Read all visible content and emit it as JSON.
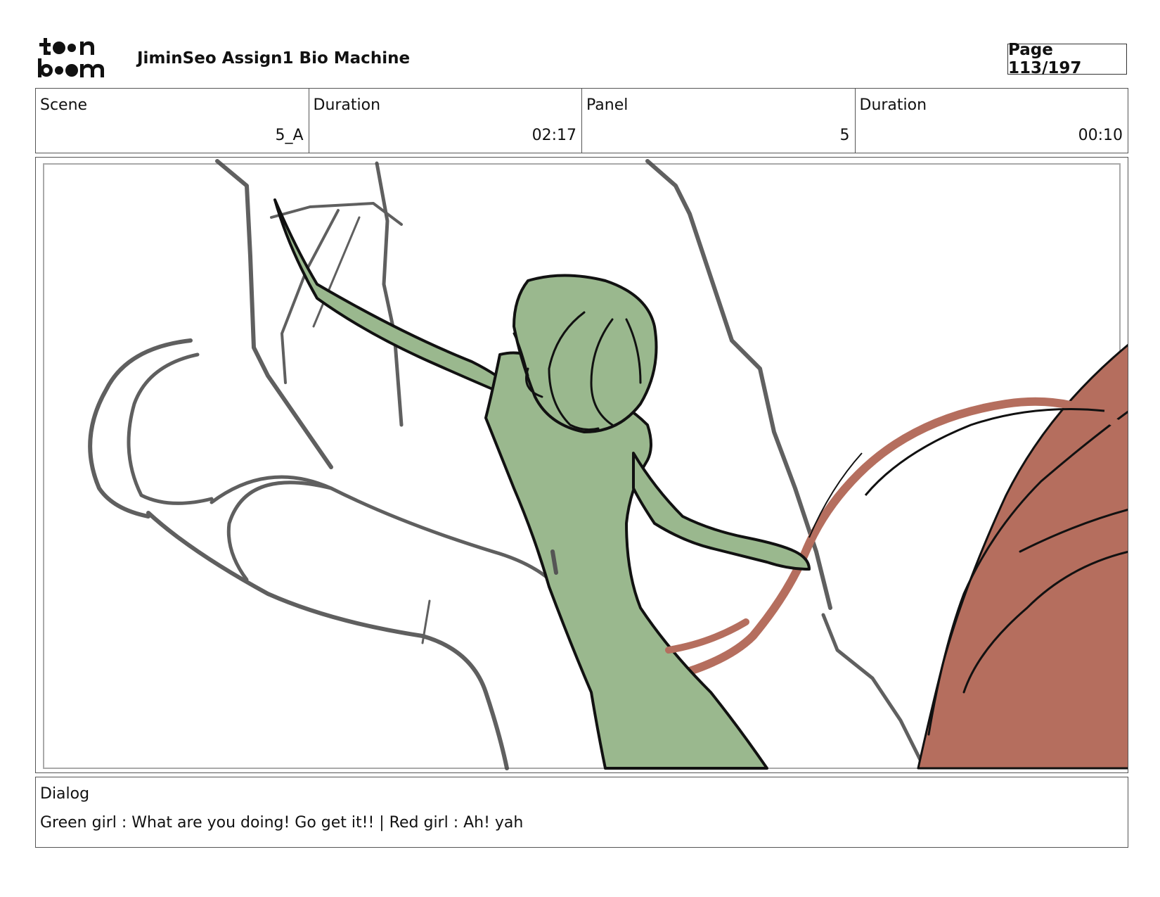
{
  "header": {
    "logo_text": "toon boom",
    "title": "JiminSeo Assign1 Bio Machine",
    "page": "Page 113/197"
  },
  "info": {
    "scene_label": "Scene",
    "scene_value": "5_A",
    "scene_duration_label": "Duration",
    "scene_duration_value": "02:17",
    "panel_label": "Panel",
    "panel_value": "5",
    "panel_duration_label": "Duration",
    "panel_duration_value": "00:10"
  },
  "panel_image": {
    "description_colors": {
      "green_character": "#9ab88e",
      "red_character": "#b56e5e",
      "sketch_lines": "#555555"
    }
  },
  "dialog": {
    "label": "Dialog",
    "text": "Green girl : What are you doing! Go get it!! | Red girl : Ah! yah"
  }
}
